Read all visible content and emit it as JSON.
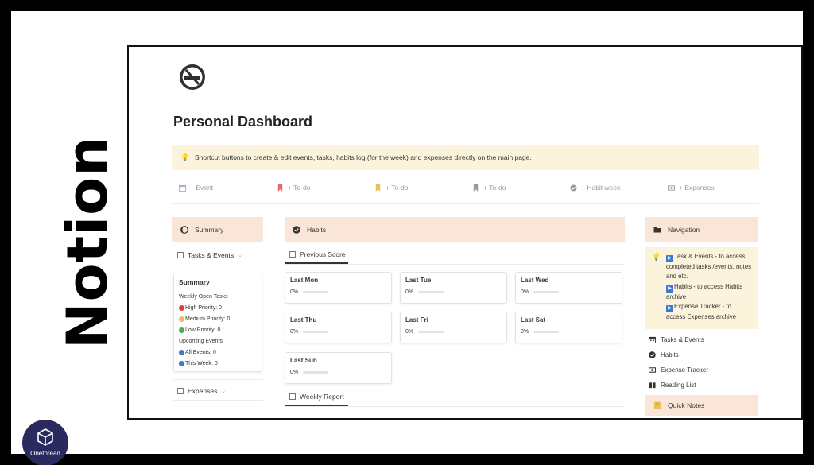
{
  "side_banner": {
    "word": "Notion"
  },
  "brand_logo": {
    "text": "Onethread"
  },
  "page": {
    "title": "Personal Dashboard",
    "page_icon": "no-smoking-icon",
    "callout": {
      "icon": "lightbulb-icon",
      "text": "Shortcut buttons to create & edit events, tasks, habits log (for the week) and expenses directly on the main page."
    },
    "shortcuts": [
      {
        "label": "+ Event",
        "icon": "calendar-icon",
        "color": "#9bb4d6"
      },
      {
        "label": "+ To-do",
        "icon": "bookmark-icon",
        "color": "#e86a6a"
      },
      {
        "label": "+ To-do",
        "icon": "bookmark-icon",
        "color": "#e8c15a"
      },
      {
        "label": "+ To-do",
        "icon": "bookmark-icon",
        "color": "#9b9a97"
      },
      {
        "label": "+ Habit week",
        "icon": "check-circle-icon",
        "color": "#9b9a97"
      },
      {
        "label": "+ Expenses",
        "icon": "money-icon",
        "color": "#9b9a97"
      }
    ]
  },
  "summary_col": {
    "header": "Summary",
    "tasks_view": "Tasks & Events",
    "box": {
      "title": "Summary",
      "weekly_open": "Weekly Open Tasks",
      "high": "High Priority: 0",
      "medium": "Medium Priority: 0",
      "low": "Low Priority: 0",
      "upcoming": "Upcoming Events",
      "all": "All Events: 0",
      "this_week": "This Week: 0"
    },
    "expenses_view": "Expenses"
  },
  "habits_col": {
    "header": "Habits",
    "tab_previous": "Previous Score",
    "tab_weekly": "Weekly Report",
    "cards": [
      {
        "name": "Last Mon",
        "score": "0%",
        "progress": 0
      },
      {
        "name": "Last Tue",
        "score": "0%",
        "progress": 0
      },
      {
        "name": "Last Wed",
        "score": "0%",
        "progress": 0
      },
      {
        "name": "Last Thu",
        "score": "0%",
        "progress": 0
      },
      {
        "name": "Last Fri",
        "score": "0%",
        "progress": 0
      },
      {
        "name": "Last Sat",
        "score": "0%",
        "progress": 0
      },
      {
        "name": "Last Sun",
        "score": "0%",
        "progress": 0
      }
    ]
  },
  "nav_col": {
    "header": "Navigation",
    "callout_lines": [
      "Task & Events - to access completed tasks /events, notes and etc.",
      "Habits - to access Habits archive",
      "Expense Tracker - to access Expenses archive"
    ],
    "links": [
      {
        "label": "Tasks & Events",
        "icon": "calendar-icon"
      },
      {
        "label": "Habits",
        "icon": "check-badge-icon"
      },
      {
        "label": "Expense Tracker",
        "icon": "money-icon"
      },
      {
        "label": "Reading List",
        "icon": "book-icon"
      }
    ],
    "quick_notes": "Quick Notes"
  },
  "colors": {
    "callout_bg": "#fbf3db",
    "header_bg": "#fae6d8",
    "priority_high": "#e03e3e",
    "priority_medium": "#e8c15a",
    "priority_low": "#4dab4d",
    "events_dot": "#3a7bd5"
  }
}
